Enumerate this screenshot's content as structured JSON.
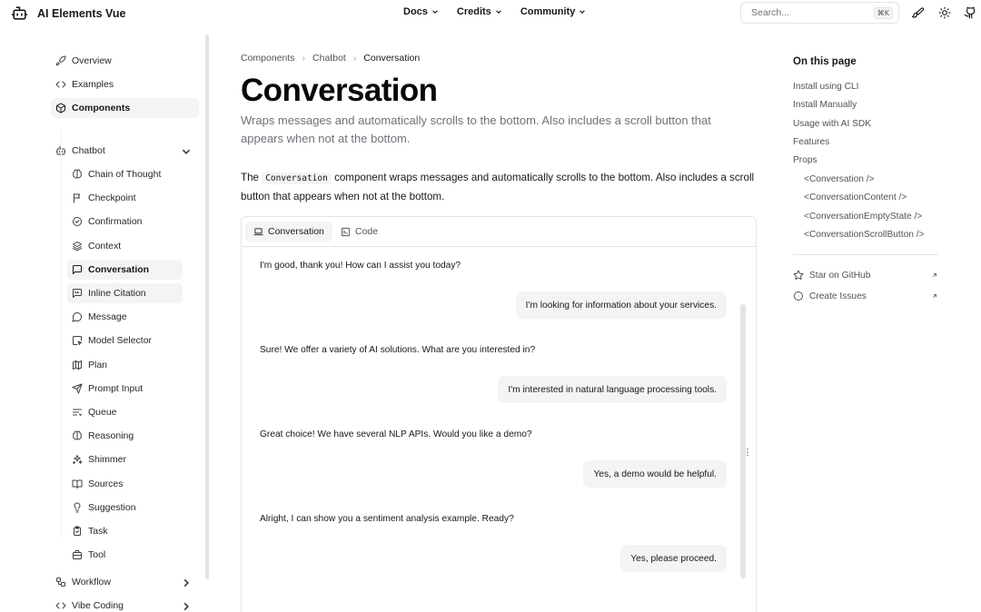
{
  "header": {
    "brand": "AI Elements Vue",
    "nav": [
      {
        "label": "Docs"
      },
      {
        "label": "Credits"
      },
      {
        "label": "Community"
      }
    ],
    "search_placeholder": "Search...",
    "search_shortcut": "⌘K"
  },
  "sidebar": {
    "top": [
      {
        "label": "Overview",
        "icon": "rocket-icon"
      },
      {
        "label": "Examples",
        "icon": "code-icon"
      },
      {
        "label": "Components",
        "icon": "box-icon"
      }
    ],
    "chatbot_label": "Chatbot",
    "chatbot_items": [
      {
        "label": "Chain of Thought",
        "icon": "brain-icon"
      },
      {
        "label": "Checkpoint",
        "icon": "flag-icon"
      },
      {
        "label": "Confirmation",
        "icon": "check-circle-icon"
      },
      {
        "label": "Context",
        "icon": "layers-icon"
      },
      {
        "label": "Conversation",
        "icon": "message-square-icon"
      },
      {
        "label": "Inline Citation",
        "icon": "quote-icon"
      },
      {
        "label": "Message",
        "icon": "message-circle-icon"
      },
      {
        "label": "Model Selector",
        "icon": "cursor-square-icon"
      },
      {
        "label": "Plan",
        "icon": "map-icon"
      },
      {
        "label": "Prompt Input",
        "icon": "send-icon"
      },
      {
        "label": "Queue",
        "icon": "list-icon"
      },
      {
        "label": "Reasoning",
        "icon": "brain-icon"
      },
      {
        "label": "Shimmer",
        "icon": "sparkles-icon"
      },
      {
        "label": "Sources",
        "icon": "book-icon"
      },
      {
        "label": "Suggestion",
        "icon": "lightbulb-icon"
      },
      {
        "label": "Task",
        "icon": "clipboard-check-icon"
      },
      {
        "label": "Tool",
        "icon": "toolbox-icon"
      }
    ],
    "bottom": [
      {
        "label": "Workflow",
        "icon": "workflow-icon"
      },
      {
        "label": "Vibe Coding",
        "icon": "code-icon"
      }
    ]
  },
  "main": {
    "breadcrumb": [
      "Components",
      "Chatbot",
      "Conversation"
    ],
    "title": "Conversation",
    "description": "Wraps messages and automatically scrolls to the bottom. Also includes a scroll button that appears when not at the bottom.",
    "para_before": "The ",
    "para_code": "Conversation",
    "para_after": " component wraps messages and automatically scrolls to the bottom. Also includes a scroll button that appears when not at the bottom.",
    "tabs": [
      {
        "label": "Conversation"
      },
      {
        "label": "Code"
      }
    ],
    "messages": [
      {
        "role": "assistant",
        "text": "I'm good, thank you! How can I assist you today?"
      },
      {
        "role": "user",
        "text": "I'm looking for information about your services."
      },
      {
        "role": "assistant",
        "text": "Sure! We offer a variety of AI solutions. What are you interested in?"
      },
      {
        "role": "user",
        "text": "I'm interested in natural language processing tools."
      },
      {
        "role": "assistant",
        "text": "Great choice! We have several NLP APIs. Would you like a demo?"
      },
      {
        "role": "user",
        "text": "Yes, a demo would be helpful."
      },
      {
        "role": "assistant",
        "text": "Alright, I can show you a sentiment analysis example. Ready?"
      },
      {
        "role": "user",
        "text": "Yes, please proceed."
      }
    ]
  },
  "toc": {
    "title": "On this page",
    "items": [
      {
        "label": "Install using CLI"
      },
      {
        "label": "Install Manually"
      },
      {
        "label": "Usage with AI SDK"
      },
      {
        "label": "Features"
      },
      {
        "label": "Props"
      }
    ],
    "props": [
      {
        "label": "<Conversation />"
      },
      {
        "label": "<ConversationContent />"
      },
      {
        "label": "<ConversationEmptyState />"
      },
      {
        "label": "<ConversationScrollButton />"
      }
    ],
    "links": [
      {
        "label": "Star on GitHub"
      },
      {
        "label": "Create Issues"
      }
    ]
  }
}
